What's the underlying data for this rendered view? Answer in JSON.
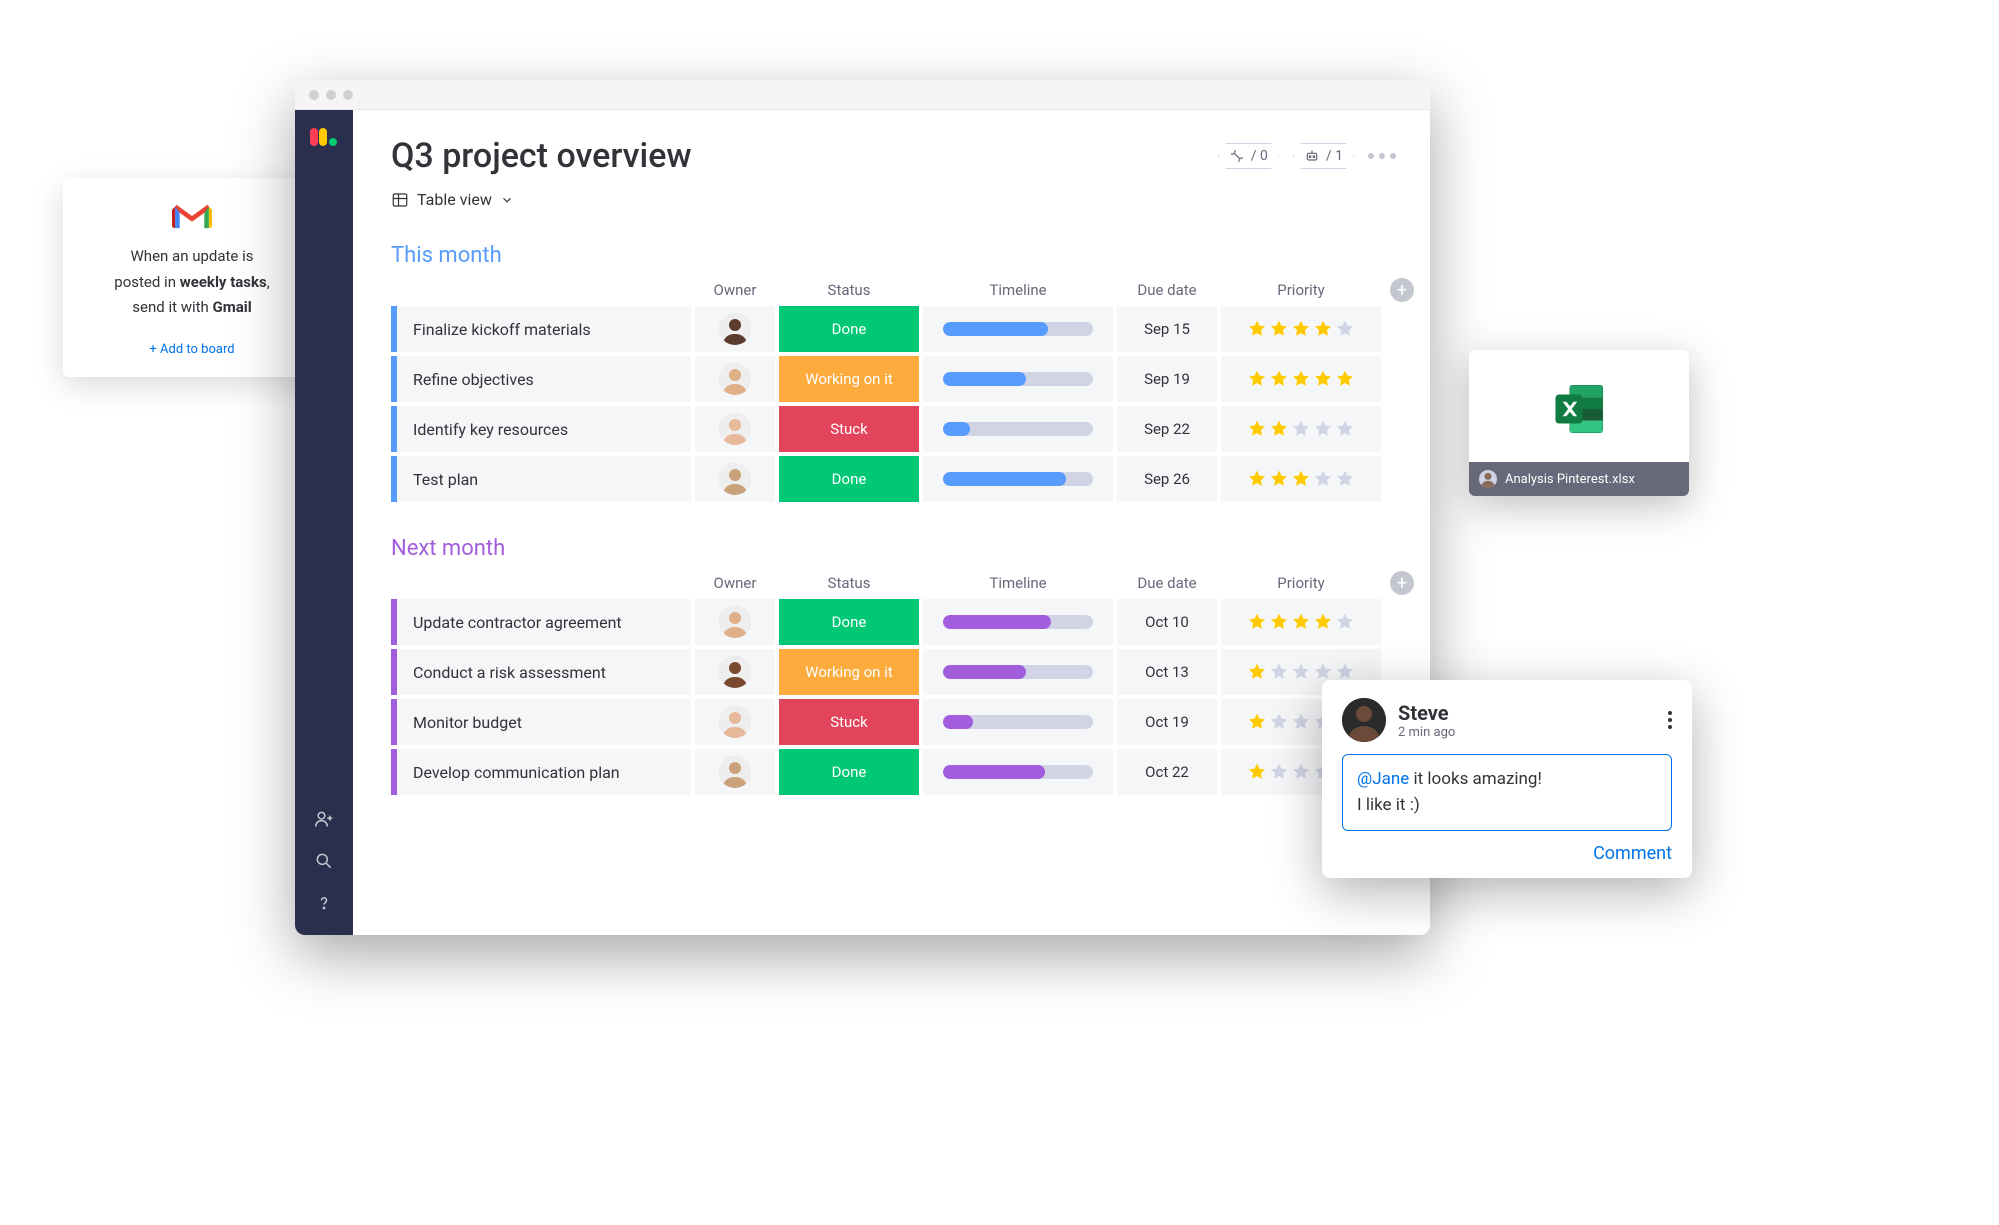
{
  "gmail_card": {
    "line1": "When an update is",
    "line2_pre": "posted in ",
    "line2_bold": "weekly tasks",
    "line2_post": ",",
    "line3_pre": "send it with ",
    "line3_bold": "Gmail",
    "add": "+ Add to board"
  },
  "header": {
    "title": "Q3 project overview",
    "view_label": "Table view",
    "pill_integrations": "/ 0",
    "pill_automations": "/ 1"
  },
  "columns": [
    "",
    "Owner",
    "Status",
    "Timeline",
    "Due date",
    "Priority",
    ""
  ],
  "status_labels": {
    "done": "Done",
    "working": "Working on it",
    "stuck": "Stuck"
  },
  "groups": [
    {
      "name": "This month",
      "accent": "#579bfc",
      "rows": [
        {
          "task": "Finalize kickoff materials",
          "status": "done",
          "timeline_from": 0,
          "timeline_to": 0.7,
          "due": "Sep 15",
          "stars": 4,
          "tl_color": "#579bfc",
          "avatar": "f1"
        },
        {
          "task": "Refine objectives",
          "status": "working",
          "timeline_from": 0,
          "timeline_to": 0.55,
          "due": "Sep 19",
          "stars": 5,
          "tl_color": "#579bfc",
          "avatar": "m1"
        },
        {
          "task": "Identify key resources",
          "status": "stuck",
          "timeline_from": 0,
          "timeline_to": 0.18,
          "due": "Sep 22",
          "stars": 2,
          "tl_color": "#579bfc",
          "avatar": "f2"
        },
        {
          "task": "Test plan",
          "status": "done",
          "timeline_from": 0,
          "timeline_to": 0.82,
          "due": "Sep 26",
          "stars": 3,
          "tl_color": "#579bfc",
          "avatar": "m2"
        }
      ]
    },
    {
      "name": "Next month",
      "accent": "#a25ddc",
      "rows": [
        {
          "task": "Update contractor agreement",
          "status": "done",
          "timeline_from": 0,
          "timeline_to": 0.72,
          "due": "Oct 10",
          "stars": 4,
          "tl_color": "#a25ddc",
          "avatar": "m1"
        },
        {
          "task": "Conduct a risk assessment",
          "status": "working",
          "timeline_from": 0,
          "timeline_to": 0.55,
          "due": "Oct 13",
          "stars": 1,
          "tl_color": "#a25ddc",
          "avatar": "m3"
        },
        {
          "task": "Monitor budget",
          "status": "stuck",
          "timeline_from": 0,
          "timeline_to": 0.2,
          "due": "Oct 19",
          "stars": 1,
          "tl_color": "#a25ddc",
          "avatar": "f2"
        },
        {
          "task": "Develop communication plan",
          "status": "done",
          "timeline_from": 0,
          "timeline_to": 0.68,
          "due": "Oct 22",
          "stars": 1,
          "tl_color": "#a25ddc",
          "avatar": "m2"
        }
      ]
    }
  ],
  "excel_card": {
    "file": "Analysis Pinterest.xlsx"
  },
  "comment_card": {
    "name": "Steve",
    "time": "2 min ago",
    "mention": "@Jane",
    "line1_rest": " it looks amazing!",
    "line2": "I like it :)",
    "action": "Comment"
  }
}
